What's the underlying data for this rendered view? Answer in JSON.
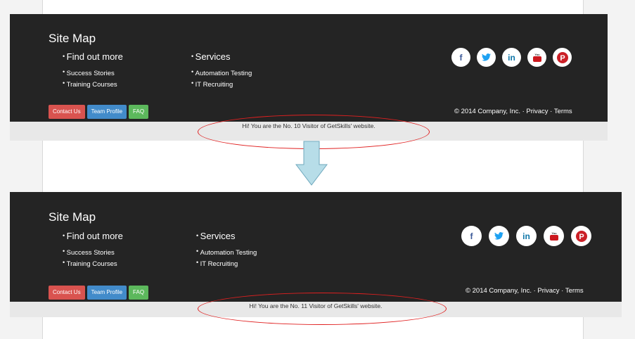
{
  "before": {
    "site_map_title": "Site Map",
    "columns": [
      {
        "heading": "Find out more",
        "links": [
          "Success Stories",
          "Training Courses"
        ]
      },
      {
        "heading": "Services",
        "links": [
          "Automation Testing",
          "IT Recruiting"
        ]
      }
    ],
    "social_icons": [
      {
        "name": "facebook-icon",
        "glyph": "f",
        "color": "#3b5998"
      },
      {
        "name": "twitter-icon",
        "glyph": "🐦",
        "color": "#1da1f2"
      },
      {
        "name": "linkedin-icon",
        "glyph": "in",
        "color": "#0e76a8"
      },
      {
        "name": "youtube-icon",
        "glyph": "▶",
        "color": "#cc181e"
      },
      {
        "name": "pinterest-icon",
        "glyph": "P",
        "color": "#cb2027"
      }
    ],
    "buttons": {
      "contact": "Contact Us",
      "team": "Team Profile",
      "faq": "FAQ"
    },
    "copyright": "© 2014 Company, Inc. · Privacy · Terms",
    "visitor_text": "Hi! You are the No. 10 Visitor of GetSkills' website."
  },
  "after": {
    "site_map_title": "Site Map",
    "columns": [
      {
        "heading": "Find out more",
        "links": [
          "Success Stories",
          "Training Courses"
        ]
      },
      {
        "heading": "Services",
        "links": [
          "Automation Testing",
          "IT Recruiting"
        ]
      }
    ],
    "buttons": {
      "contact": "Contact Us",
      "team": "Team Profile",
      "faq": "FAQ"
    },
    "copyright": "© 2014 Company, Inc. · Privacy · Terms",
    "visitor_text": "Hi! You are the No. 11 Visitor of GetSkills' website."
  },
  "colors": {
    "footer_bg": "#242424",
    "annotation_red": "#e02020",
    "arrow_fill": "#b7dde8"
  }
}
